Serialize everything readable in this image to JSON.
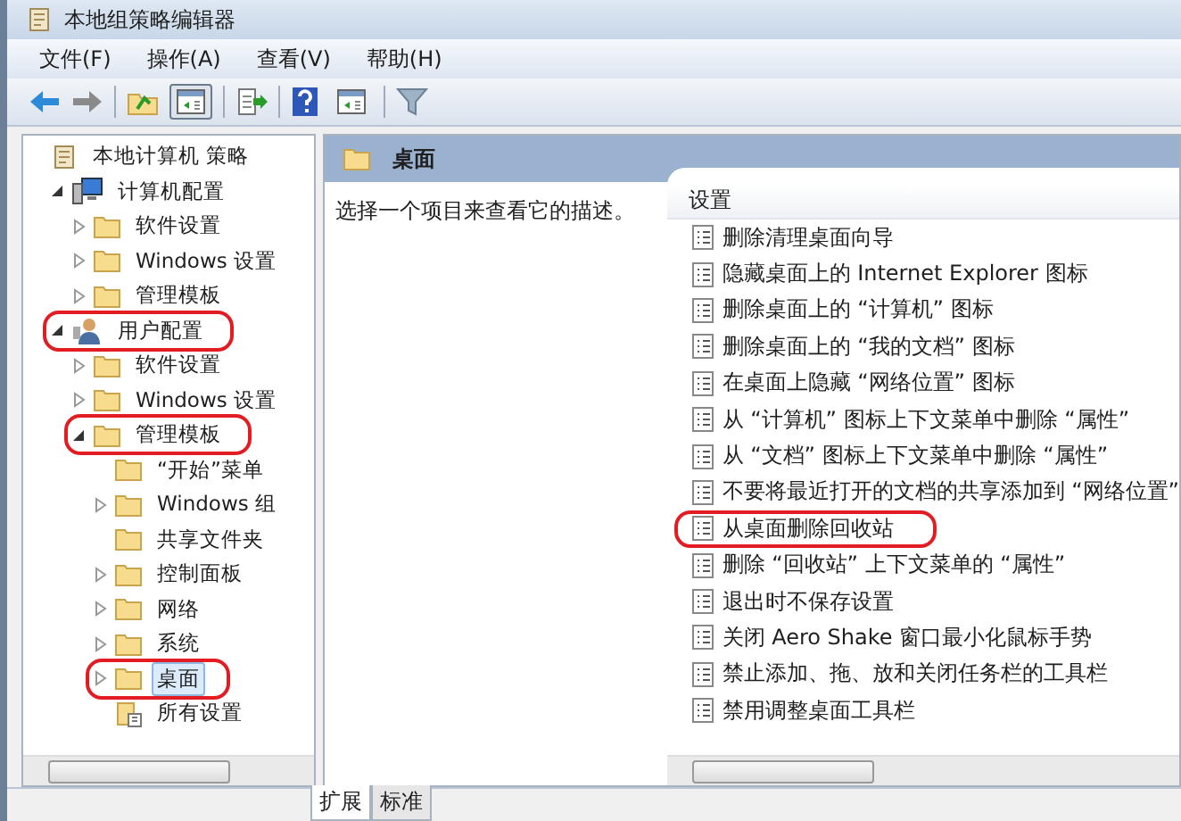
{
  "window": {
    "title": "本地组策略编辑器"
  },
  "menu": [
    "文件(F)",
    "操作(A)",
    "查看(V)",
    "帮助(H)"
  ],
  "toolbar": [
    {
      "kind": "back"
    },
    {
      "kind": "forward"
    },
    {
      "kind": "sep"
    },
    {
      "kind": "up"
    },
    {
      "kind": "pane",
      "selected": true
    },
    {
      "kind": "sep"
    },
    {
      "kind": "export"
    },
    {
      "kind": "sep"
    },
    {
      "kind": "help"
    },
    {
      "kind": "pane",
      "selected": false
    },
    {
      "kind": "sep"
    },
    {
      "kind": "filter"
    }
  ],
  "tree": [
    {
      "label": "本地计算机 策略",
      "kind": "policy",
      "selected": false,
      "circled": false,
      "children": [
        {
          "label": "计算机配置",
          "kind": "computer",
          "expanded": true,
          "selected": false,
          "circled": false,
          "children": [
            {
              "label": "软件设置",
              "kind": "folder",
              "expanded": false,
              "selected": false,
              "circled": false
            },
            {
              "label": "Windows 设置",
              "kind": "folder",
              "expanded": false,
              "selected": false,
              "circled": false
            },
            {
              "label": "管理模板",
              "kind": "folder",
              "expanded": false,
              "selected": false,
              "circled": false
            }
          ]
        },
        {
          "label": "用户配置",
          "kind": "user",
          "expanded": true,
          "selected": false,
          "circled": true,
          "children": [
            {
              "label": "软件设置",
              "kind": "folder",
              "expanded": false,
              "selected": false,
              "circled": false
            },
            {
              "label": "Windows 设置",
              "kind": "folder",
              "expanded": false,
              "selected": false,
              "circled": false
            },
            {
              "label": "管理模板",
              "kind": "folder",
              "expanded": true,
              "selected": false,
              "circled": true,
              "children": [
                {
                  "label": "“开始”菜单",
                  "kind": "folder",
                  "selected": false,
                  "circled": false
                },
                {
                  "label": "Windows 组",
                  "kind": "folder",
                  "expanded": false,
                  "selected": false,
                  "circled": false
                },
                {
                  "label": "共享文件夹",
                  "kind": "folder",
                  "selected": false,
                  "circled": false
                },
                {
                  "label": "控制面板",
                  "kind": "folder",
                  "expanded": false,
                  "selected": false,
                  "circled": false
                },
                {
                  "label": "网络",
                  "kind": "folder",
                  "expanded": false,
                  "selected": false,
                  "circled": false
                },
                {
                  "label": "系统",
                  "kind": "folder",
                  "expanded": false,
                  "selected": false,
                  "circled": false
                },
                {
                  "label": "桌面",
                  "kind": "folder",
                  "expanded": false,
                  "selected": true,
                  "circled": true
                },
                {
                  "label": "所有设置",
                  "kind": "settings",
                  "selected": false,
                  "circled": false
                }
              ]
            }
          ]
        }
      ]
    }
  ],
  "content": {
    "title": "桌面",
    "description": "选择一个项目来查看它的描述。",
    "column": "设置",
    "settings": [
      {
        "label": "删除清理桌面向导",
        "circled": false
      },
      {
        "label": "隐藏桌面上的 Internet Explorer 图标",
        "circled": false
      },
      {
        "label": "删除桌面上的 “计算机” 图标",
        "circled": false
      },
      {
        "label": "删除桌面上的 “我的文档” 图标",
        "circled": false
      },
      {
        "label": "在桌面上隐藏 “网络位置” 图标",
        "circled": false
      },
      {
        "label": "从 “计算机” 图标上下文菜单中删除 “属性”",
        "circled": false
      },
      {
        "label": "从 “文档” 图标上下文菜单中删除 “属性”",
        "circled": false
      },
      {
        "label": "不要将最近打开的文档的共享添加到 “网络位置”",
        "circled": false
      },
      {
        "label": "从桌面删除回收站",
        "circled": true
      },
      {
        "label": "删除 “回收站” 上下文菜单的 “属性”",
        "circled": false
      },
      {
        "label": "退出时不保存设置",
        "circled": false
      },
      {
        "label": "关闭 Aero Shake 窗口最小化鼠标手势",
        "circled": false
      },
      {
        "label": "禁止添加、拖、放和关闭任务栏的工具栏",
        "circled": false
      },
      {
        "label": "禁用调整桌面工具栏",
        "circled": false
      }
    ]
  },
  "view_tabs": [
    {
      "label": "扩展",
      "selected": true
    },
    {
      "label": "标准",
      "selected": false
    }
  ]
}
